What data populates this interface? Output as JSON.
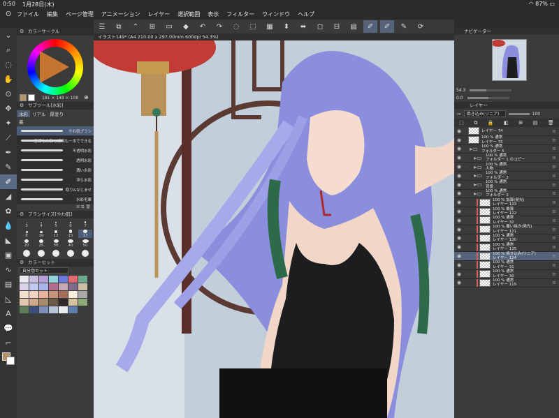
{
  "status": {
    "time": "0:50",
    "date": "1月28日(木)",
    "battery": "87%"
  },
  "menu": [
    "ファイル",
    "編集",
    "ページ管理",
    "アニメーション",
    "レイヤー",
    "選択範囲",
    "表示",
    "フィルター",
    "ウィンドウ",
    "ヘルプ"
  ],
  "toolbar": [
    "☰",
    "⧉",
    "⌃",
    "⊞",
    "▭",
    "◆",
    "↶",
    "↷",
    "◌",
    "⬚",
    "▦",
    "⬍",
    "⬌",
    "◻",
    "⊟",
    "▤",
    "✐",
    "✐",
    "✎",
    "⟳"
  ],
  "canvas": {
    "title": "イラスト149* (A4 210.00 x 297.00mm 600dpi 54.3%)"
  },
  "palette": {
    "colorcircle_title": "カラーサークル",
    "rgb": "181 × 148 × 108",
    "subtool_title": "サブツール[水彩]",
    "subtool_tabs": [
      "水彩",
      "リアル",
      "厚塗り"
    ],
    "subtool_tab2": "墨",
    "brushes": [
      "やわ肌ブラシ",
      "王様も水彩も線画も一本でできる",
      "不透明水彩",
      "透明水彩",
      "濃い水彩",
      "滲ら水彩",
      "取り&なじませ",
      "水彩毛筆"
    ],
    "brushsize_title": "ブラシサイズ[やわ肌]",
    "sizes": [
      "3",
      "4",
      "5",
      "6",
      "7",
      "8",
      "10",
      "12",
      "15",
      "17",
      "20",
      "25",
      "30",
      "40",
      "50",
      "",
      "",
      "",
      "",
      ""
    ],
    "colorset_title": "カラーセット",
    "colorset_select": "自分用セット"
  },
  "colorset_colors": [
    "#eaeaf0",
    "#c7c0e0",
    "#b79fd6",
    "#8fd3d8",
    "#6b79d8",
    "#e06a72",
    "#6fa890",
    "#dcd2ea",
    "#c0c9ef",
    "#a8b4e8",
    "#b36b8e",
    "#c9a8b4",
    "#7e6c8a",
    "#cdbfa8",
    "#efe0cc",
    "#f2d2c2",
    "#e8b49c",
    "#c4937a",
    "#a46e58",
    "#fbf0e0",
    "#a8a8a8",
    "#e0c8b0",
    "#d0a88a",
    "#a78a6c",
    "#6c5a48",
    "#2e2a2a",
    "#d6c0a0",
    "#8ea87a",
    "#5e7e5a",
    "#3e4e7e",
    "#7e8eb8",
    "#b8c4d8",
    "#e8ecf0",
    "#5e7eae"
  ],
  "right": {
    "navigator_title": "ナビゲーター",
    "zoom": "54.3",
    "rotate": "0.0",
    "layer_title": "レイヤー",
    "blend": "焼き込み(リニア)",
    "opacity": "100",
    "layers": [
      {
        "l1": "",
        "l2": "レイヤー 74",
        "type": "thumb",
        "indent": 0
      },
      {
        "l1": "100 % 通常",
        "l2": "レイヤー 75",
        "type": "thumb",
        "indent": 0
      },
      {
        "l1": "100 % 通常",
        "l2": "フォルダー 5",
        "type": "folder",
        "indent": 0
      },
      {
        "l1": "100 % 通常",
        "l2": "フォルダー 1 のコピー",
        "type": "folder",
        "indent": 1
      },
      {
        "l1": "100 % 通常",
        "l2": "人物",
        "type": "folder",
        "indent": 1
      },
      {
        "l1": "100 % 通常",
        "l2": "フォルダー 2",
        "type": "folder",
        "indent": 1
      },
      {
        "l1": "100 % 通常",
        "l2": "背景",
        "type": "folder",
        "indent": 1
      },
      {
        "l1": "100 % 通常",
        "l2": "フォルダー 3",
        "type": "folder",
        "indent": 1
      },
      {
        "l1": "100 % 加算(発光)",
        "l2": "レイヤー 123",
        "type": "thumb",
        "indent": 2
      },
      {
        "l1": "100 % 乗算",
        "l2": "レイヤー 122",
        "type": "thumb",
        "indent": 2
      },
      {
        "l1": "100 % 通常",
        "l2": "レイヤー 32",
        "type": "thumb",
        "indent": 2
      },
      {
        "l1": "100 % 覆い焼き(発光)",
        "l2": "レイヤー 121",
        "type": "thumb",
        "indent": 2
      },
      {
        "l1": "100 % 通常",
        "l2": "レイヤー 120",
        "type": "thumb",
        "indent": 2
      },
      {
        "l1": "100 % 通常",
        "l2": "レイヤー 125",
        "type": "thumb",
        "indent": 2
      },
      {
        "l1": "100 % 焼き込み(リニア)",
        "l2": "レイヤー 124",
        "type": "thumb",
        "indent": 2,
        "active": true
      },
      {
        "l1": "100 % 通常",
        "l2": "レイヤー 31",
        "type": "thumb",
        "indent": 2
      },
      {
        "l1": "100 % 通常",
        "l2": "レイヤー 30",
        "type": "thumb",
        "indent": 2
      },
      {
        "l1": "100 % 通常",
        "l2": "レイヤー 119",
        "type": "thumb",
        "indent": 2
      }
    ]
  }
}
